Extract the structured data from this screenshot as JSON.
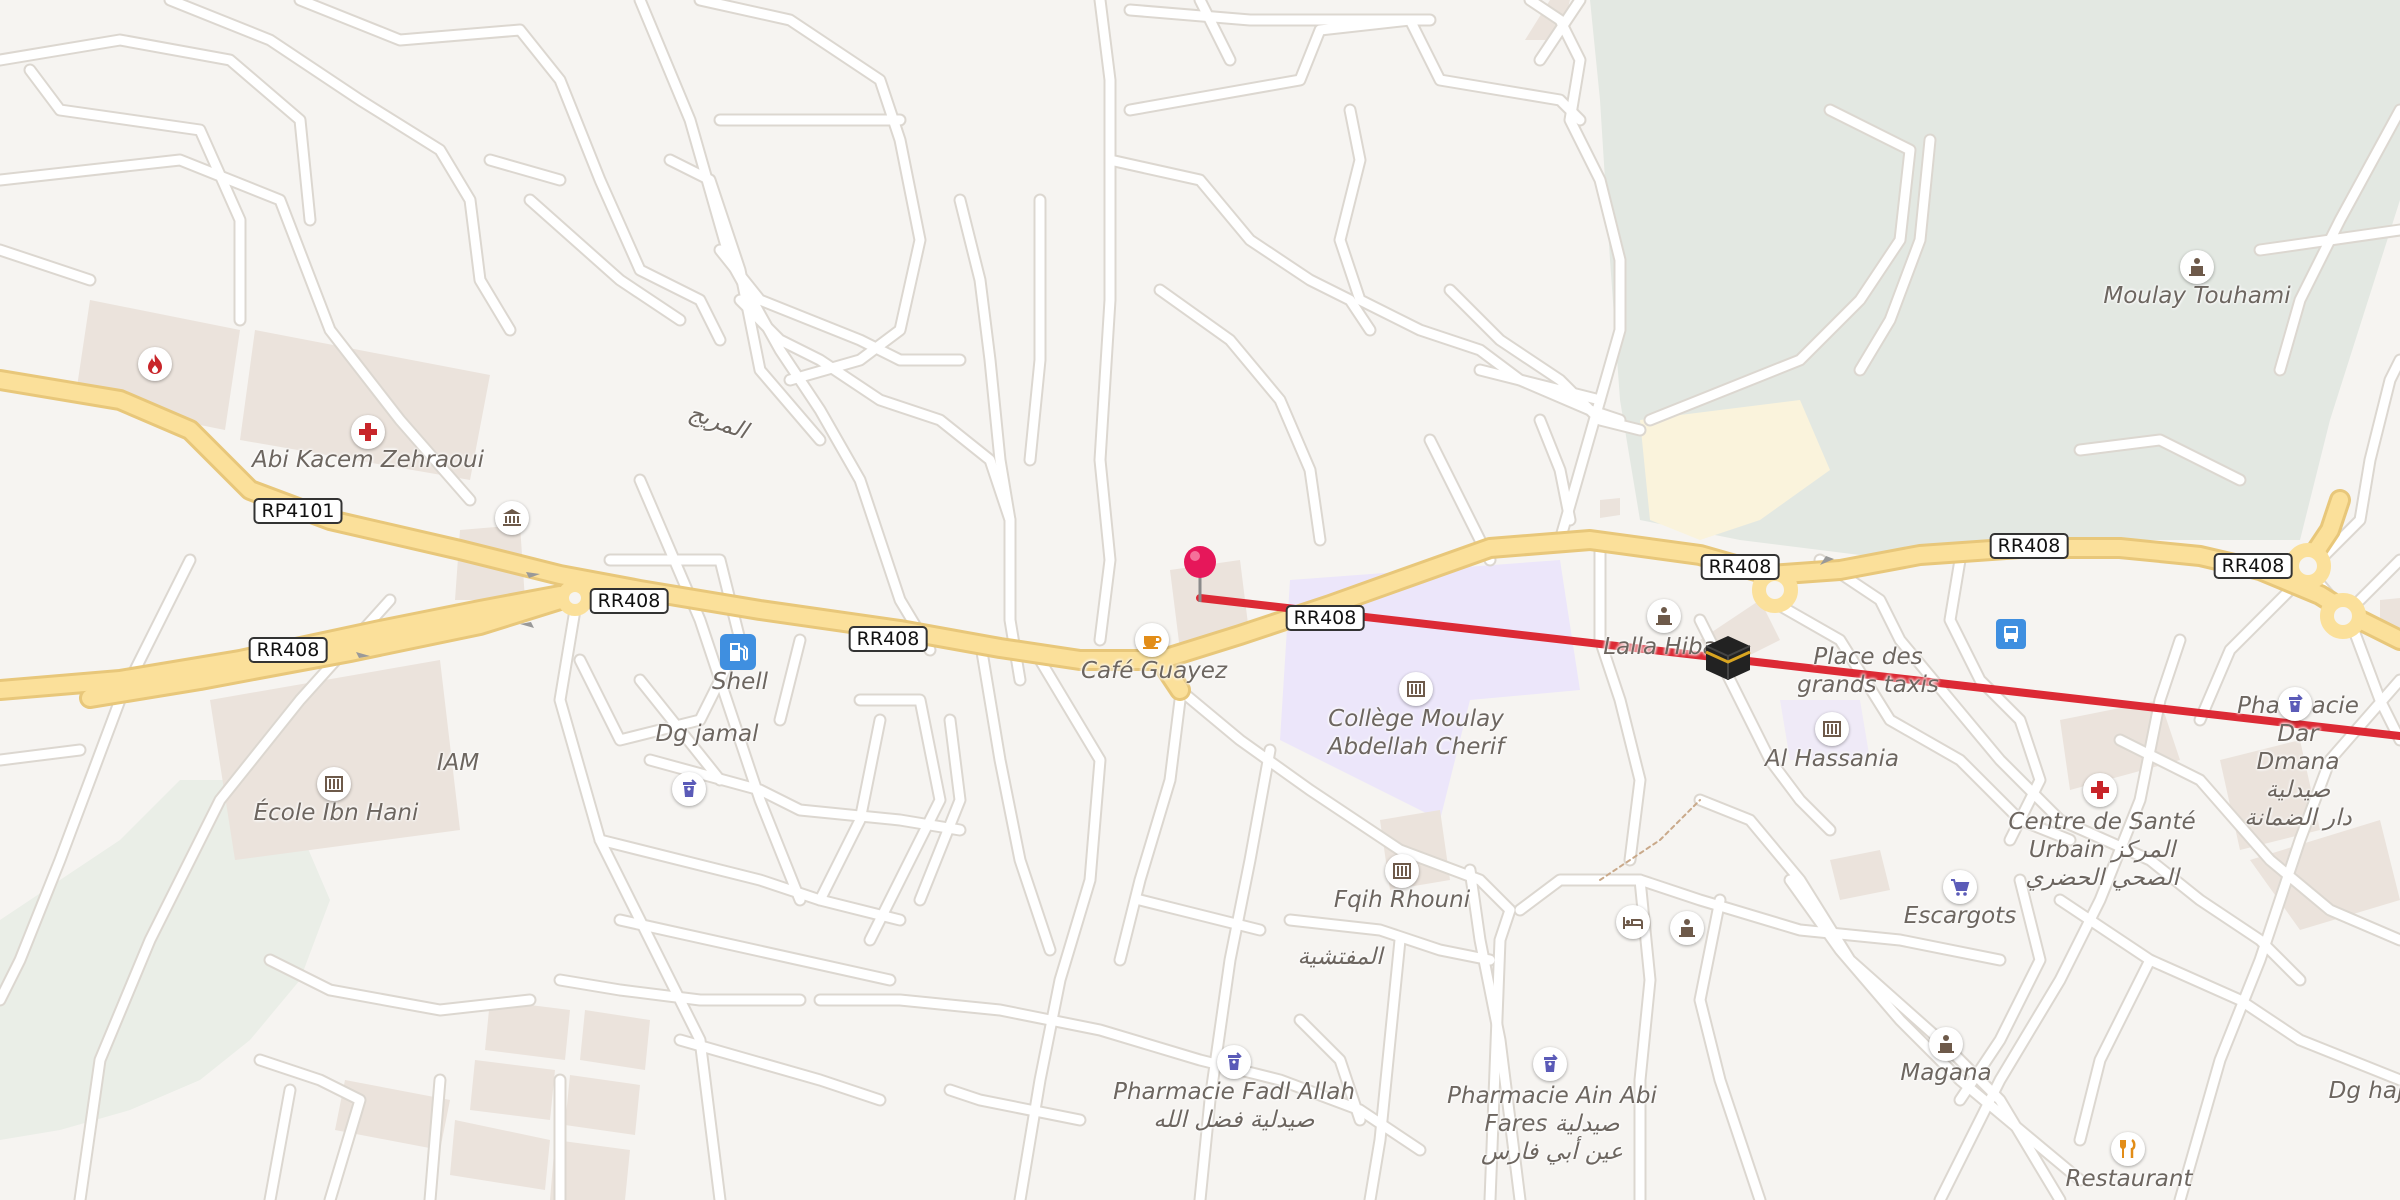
{
  "roads": {
    "rp4101": "RP4101",
    "rr408_a": "RR408",
    "rr408_b": "RR408",
    "rr408_c": "RR408",
    "rr408_d": "RR408",
    "rr408_e": "RR408",
    "rr408_f": "RR408",
    "rr408_g": "RR408"
  },
  "places": {
    "abi_kacem": "Abi Kacem Zehraoui",
    "cafe_guayez": "Café Guayez",
    "shell": "Shell",
    "dg_jamal": "Dg jamal",
    "iam": "IAM",
    "ecole_ibn_hani": "École Ibn Hani",
    "college": "Collège Moulay\nAbdellah Cherif",
    "lalla_hiba": "Lalla Hiba",
    "place_taxis": "Place des\ngrands taxis",
    "al_hassania": "Al Hassania",
    "moulay_touhami": "Moulay Touhami",
    "pharmacie_dar": "Pharmacie Dar\nDmana صيدلية\nدار الضمانة",
    "centre_sante": "Centre de Santé\nUrbain المركز\nالصحي الحضري",
    "escargots": "Escargots",
    "fqih_rhouni": "Fqih Rhouni",
    "moufatichia": "المفتشية",
    "pharmacie_fadl": "Pharmacie Fadl Allah\nصيدلية فضل الله",
    "pharmacie_ain": "Pharmacie Ain Abi\nFares صيدلية\nعين أبي فارس",
    "magana": "Magana",
    "restaurant": "Restaurant",
    "dg_haj": "Dg haj",
    "mradij": "المريج"
  },
  "icons": {
    "fire_station": "fire-station-icon",
    "hospital": "hospital-cross-icon",
    "town_hall": "town-hall-icon",
    "fuel": "fuel-pump-icon",
    "school": "school-icon",
    "pharmacy": "pharmacy-icon",
    "cafe": "cafe-cup-icon",
    "kaaba": "kaaba-mosque-icon",
    "bus": "bus-stop-icon",
    "shop": "shopping-cart-icon",
    "hotel": "hotel-bed-icon",
    "memorial": "memorial-icon",
    "restaurant": "fork-knife-icon",
    "pin": "location-pin-icon"
  },
  "colors": {
    "background": "#f6f4f1",
    "road_minor": "#ffffff",
    "road_casing": "#dcd7d0",
    "road_major": "#fbe09a",
    "road_major_casing": "#e8c77a",
    "park": "#e3e8e2",
    "school_area": "#ece6fa",
    "building": "#ebe3dc",
    "route_line": "#dc2a35",
    "pin": "#e6175a",
    "poi_red": "#c8252a",
    "poi_purple": "#5b5bb8",
    "poi_orange": "#e28d18",
    "poi_blue": "#3f8fe0",
    "poi_brown": "#6e5a4a"
  }
}
